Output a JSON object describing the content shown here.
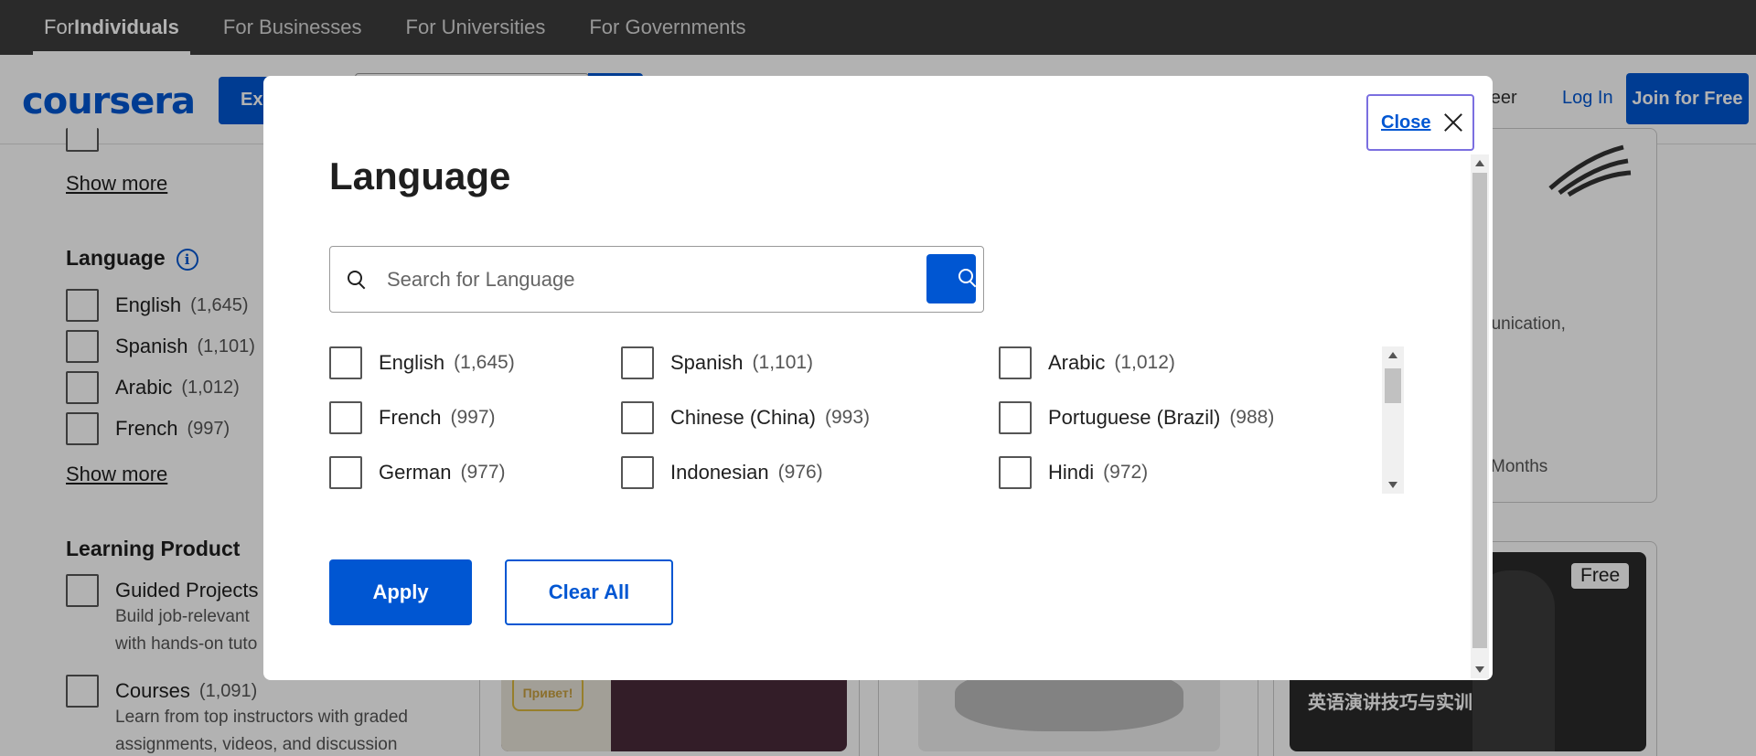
{
  "audience_tabs": [
    {
      "prefix": "For ",
      "bold": "Individuals"
    },
    {
      "label": "For Businesses"
    },
    {
      "label": "For Universities"
    },
    {
      "label": "For Governments"
    }
  ],
  "header": {
    "logo": "coursera",
    "explore_label": "Explore",
    "career_link": "areer",
    "login_label": "Log In",
    "join_label": "Join for Free"
  },
  "sidebar": {
    "show_more_1": "Show more",
    "language_title": "Language",
    "info_symbol": "i",
    "languages": [
      {
        "label": "English",
        "count": "(1,645)"
      },
      {
        "label": "Spanish",
        "count": "(1,101)"
      },
      {
        "label": "Arabic",
        "count": "(1,012)"
      },
      {
        "label": "French",
        "count": "(997)"
      }
    ],
    "show_more_2": "Show more",
    "learning_product_title": "Learning Product",
    "products": [
      {
        "label": "Guided Projects",
        "count": "",
        "desc1": "Build job-relevant",
        "desc2": "with hands-on tuto"
      },
      {
        "label": "Courses",
        "count": "(1,091)",
        "desc1": "Learn from top instructors with graded",
        "desc2": "assignments, videos, and discussion"
      }
    ]
  },
  "cards": {
    "text_communication": "nunication,",
    "text_months": "Months",
    "free_badge": "Free",
    "thumb_caption": "英语演讲技巧与实训",
    "thumb_sign": "Привет!"
  },
  "modal": {
    "close_label": "Close",
    "title": "Language",
    "search_placeholder": "Search for Language",
    "languages": [
      {
        "label": "English",
        "count": "(1,645)"
      },
      {
        "label": "Spanish",
        "count": "(1,101)"
      },
      {
        "label": "Arabic",
        "count": "(1,012)"
      },
      {
        "label": "French",
        "count": "(997)"
      },
      {
        "label": "Chinese (China)",
        "count": "(993)"
      },
      {
        "label": "Portuguese (Brazil)",
        "count": "(988)"
      },
      {
        "label": "German",
        "count": "(977)"
      },
      {
        "label": "Indonesian",
        "count": "(976)"
      },
      {
        "label": "Hindi",
        "count": "(972)"
      }
    ],
    "apply_label": "Apply",
    "clear_label": "Clear All"
  }
}
